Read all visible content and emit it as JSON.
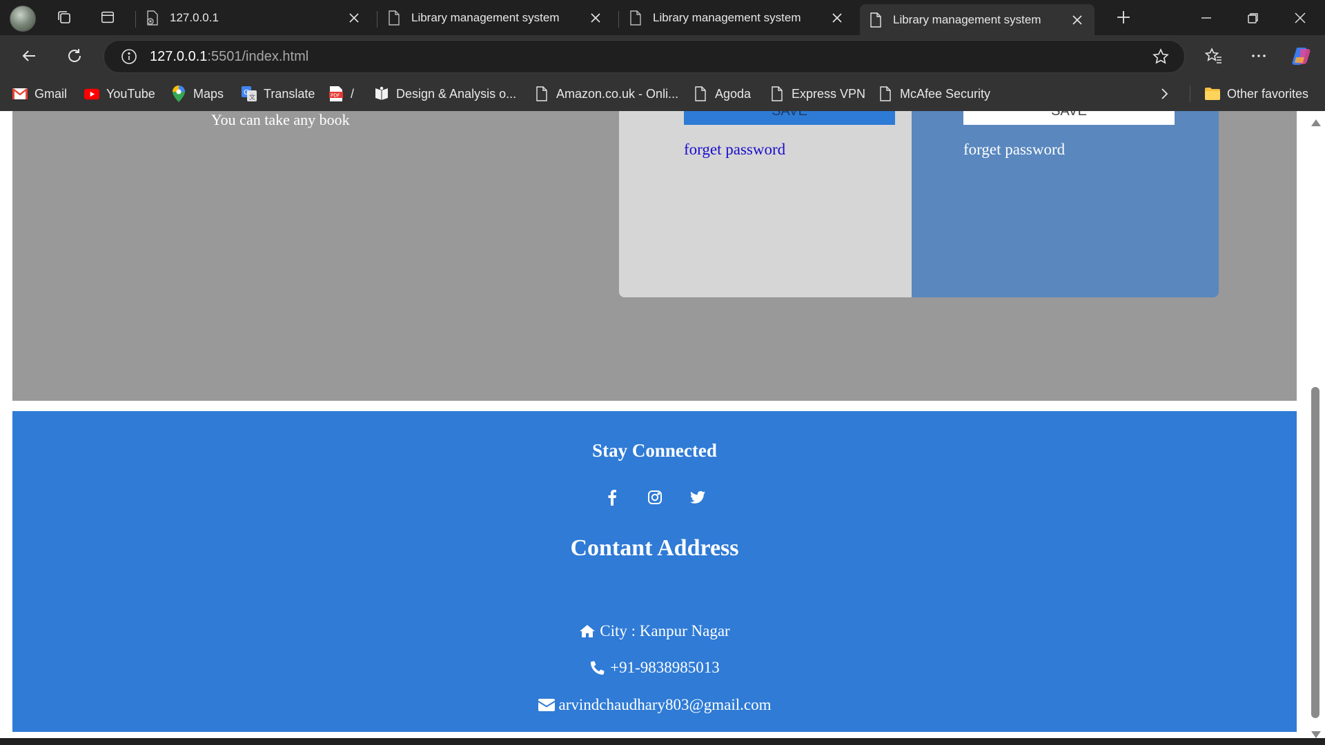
{
  "browser": {
    "tabs": [
      {
        "label": "127.0.0.1",
        "active": false
      },
      {
        "label": "Library management system",
        "active": false
      },
      {
        "label": "Library management system",
        "active": false
      },
      {
        "label": "Library management system",
        "active": true
      }
    ],
    "address": {
      "host": "127.0.0.1",
      "rest": ":5501/index.html"
    },
    "favorites": [
      {
        "label": "Gmail",
        "icon": "gmail-icon"
      },
      {
        "label": "YouTube",
        "icon": "youtube-icon"
      },
      {
        "label": "Maps",
        "icon": "maps-icon"
      },
      {
        "label": "Translate",
        "icon": "translate-icon"
      },
      {
        "label": "/",
        "icon": "pdf-icon"
      },
      {
        "label": "Design & Analysis o...",
        "icon": "book-icon"
      },
      {
        "label": "Amazon.co.uk - Onli...",
        "icon": "page-icon"
      },
      {
        "label": "Agoda",
        "icon": "page-icon"
      },
      {
        "label": "Express VPN",
        "icon": "page-icon"
      },
      {
        "label": "McAfee Security",
        "icon": "page-icon"
      }
    ],
    "other_favorites": "Other favorites"
  },
  "page": {
    "tagline": "You can take any book",
    "login": {
      "save_label": "SAVE",
      "forget_label": "forget password"
    },
    "signup": {
      "save_label": "SAVE",
      "forget_label": "forget password"
    },
    "footer": {
      "stay_title": "Stay Connected",
      "socials": [
        "facebook-icon",
        "instagram-icon",
        "twitter-icon"
      ],
      "address_title": "Contant Address",
      "city": "City : Kanpur Nagar",
      "phone": "+91-9838985013",
      "email": "arvindchaudhary803@gmail.com"
    }
  },
  "colors": {
    "gray_section": "#999999",
    "login_card": "#d6d6d6",
    "signup_card": "#5987be",
    "footer": "#2f7bd6",
    "link": "#1a0dcc"
  }
}
